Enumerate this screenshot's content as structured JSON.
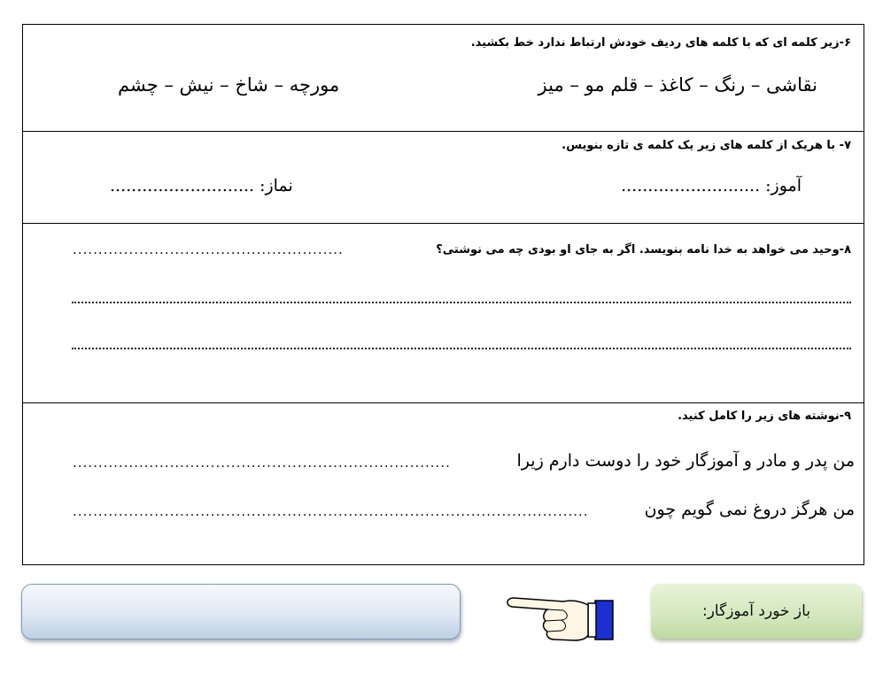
{
  "q6": {
    "title": "۶-زیر کلمه ای که با کلمه های ردیف خودش ارتباط ندارد خط بکشید.",
    "row_right": "نقاشی – رنگ – کاغذ – قلم مو – میز",
    "row_left": "مورچه – شاخ – نیش – چشم"
  },
  "q7": {
    "title": "۷- با هریک از کلمه های زیر یک کلمه ی تازه بنویس.",
    "word_right": "آموز: ..........................",
    "word_left": "نماز: ...........................",
    "dots_left": "..............................."
  },
  "q8": {
    "title": "۸-وحید می خواهد به خدا نامه بنویسد. اگر به جای او بودی چه می نوشتی؟",
    "answer_dots": "....................................................."
  },
  "q9": {
    "title": "۹-نوشته های زیر را کامل کنید.",
    "line1": "من پدر و مادر و آموزگار خود را دوست دارم زیرا",
    "line1_dots": "..........................................................................",
    "line2": "من هرگز دروغ نمی گویم چون",
    "line2_dots": "....................................................................................................."
  },
  "feedback": {
    "label": "باز خورد آموزگار:",
    "hand_icon": "pointing-hand-icon"
  }
}
